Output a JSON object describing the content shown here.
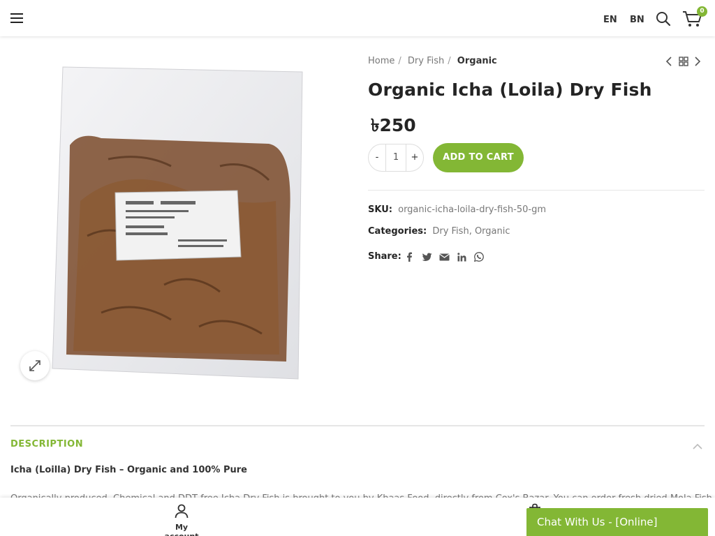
{
  "header": {
    "lang_en": "EN",
    "lang_bn": "BN",
    "cart_count": "0"
  },
  "breadcrumb": {
    "home": "Home",
    "category": "Dry Fish",
    "current": "Organic"
  },
  "product": {
    "title": "Organic Icha (Loila) Dry Fish",
    "price": "৳250",
    "qty_minus": "-",
    "qty_value": "1",
    "qty_plus": "+",
    "add_to_cart": "ADD TO CART",
    "sku_label": "SKU:",
    "sku": "organic-icha-loila-dry-fish-50-gm",
    "categories_label": "Categories:",
    "categories": [
      "Dry Fish",
      "Organic"
    ],
    "share_label": "Share:",
    "share_icons": [
      "facebook-icon",
      "twitter-icon",
      "email-icon",
      "linkedin-icon",
      "whatsapp-icon"
    ]
  },
  "tabs": {
    "description_label": "DESCRIPTION",
    "description_heading": "Icha (Loilla) Dry Fish – Organic and 100% Pure",
    "description_text": "Organically produced, Chemical and DDT free Icha Dry Fish is brought to you by Khaas Food, directly from Cox's Bazar. You can order fresh dried Mola Fish"
  },
  "bottom_bar": {
    "my_account": "My account"
  },
  "chat": {
    "label": "Chat With Us - [Online]"
  },
  "colors": {
    "accent": "#83b735",
    "text_dark": "#242424",
    "text_muted": "#777777"
  }
}
